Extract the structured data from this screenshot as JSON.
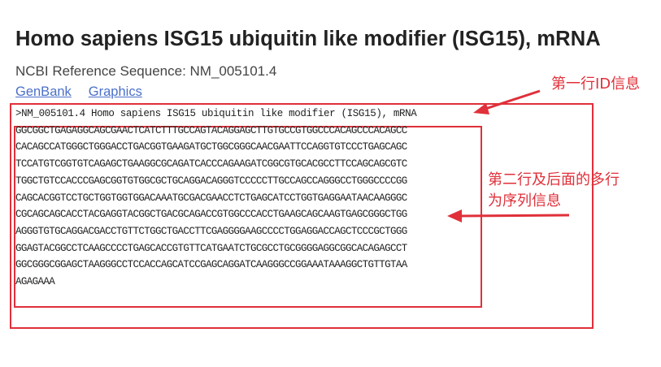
{
  "page": {
    "title": "Homo sapiens ISG15 ubiquitin like modifier (ISG15), mRNA",
    "refseq_label": "NCBI Reference Sequence: NM_005101.4",
    "links": {
      "genbank": "GenBank",
      "graphics": "Graphics"
    }
  },
  "fasta": {
    "header": ">NM_005101.4 Homo sapiens ISG15 ubiquitin like modifier (ISG15), mRNA",
    "lines": [
      "GGCGGCTGAGAGGCAGCGAACTCATCTTTGCCAGTACAGGAGCTTGTGCCGTGGCCCACAGCCCACAGCC",
      "CACAGCCATGGGCTGGGACCTGACGGTGAAGATGCTGGCGGGCAACGAATTCCAGGTGTCCCTGAGCAGC",
      "TCCATGTCGGTGTCAGAGCTGAAGGCGCAGATCACCCAGAAGATCGGCGTGCACGCCTTCCAGCAGCGTC",
      "TGGCTGTCCACCCGAGCGGTGTGGCGCTGCAGGACAGGGTCCCCCTTGCCAGCCAGGGCCTGGGCCCCGG",
      "CAGCACGGTCCTGCTGGTGGTGGACAAATGCGACGAACCTCTGAGCATCCTGGTGAGGAATAACAAGGGC",
      "CGCAGCAGCACCTACGAGGTACGGCTGACGCAGACCGTGGCCCACCTGAAGCAGCAAGTGAGCGGGCTGG",
      "AGGGTGTGCAGGACGACCTGTTCTGGCTGACCTTCGAGGGGAAGCCCCTGGAGGACCAGCTCCCGCTGGG",
      "GGAGTACGGCCTCAAGCCCCTGAGCACCGTGTTCATGAATCTGCGCCTGCGGGGAGGCGGCACAGAGCCT",
      "GGCGGGCGGAGCTAAGGGCCTCCACCAGCATCCGAGCAGGATCAAGGGCCGGAAATAAAGGCTGTTGTAA",
      "AGAGAAA"
    ]
  },
  "annotations": {
    "first_line": "第一行ID信息",
    "rest_lines_1": "第二行及后面的多行",
    "rest_lines_2": "为序列信息"
  },
  "colors": {
    "annotation": "#e0303a",
    "link": "#4a70c9"
  }
}
